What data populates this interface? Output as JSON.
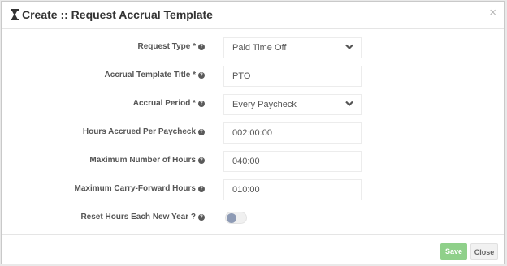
{
  "header": {
    "title": "Create :: Request Accrual Template",
    "title_icon": "hourglass-icon",
    "close_symbol": "×"
  },
  "form": {
    "request_type": {
      "label": "Request Type *",
      "value": "Paid Time Off"
    },
    "accrual_template_title": {
      "label": "Accrual Template Title *",
      "value": "PTO"
    },
    "accrual_period": {
      "label": "Accrual Period *",
      "value": "Every Paycheck"
    },
    "hours_accrued_per_paycheck": {
      "label": "Hours Accrued Per Paycheck",
      "value": "002:00:00"
    },
    "maximum_number_of_hours": {
      "label": "Maximum Number of Hours",
      "value": "040:00"
    },
    "maximum_carry_forward_hours": {
      "label": "Maximum Carry-Forward Hours",
      "value": "010:00"
    },
    "reset_hours_each_new_year": {
      "label": "Reset Hours Each New Year ?",
      "enabled": false
    },
    "help_symbol": "?"
  },
  "footer": {
    "save_label": "Save",
    "close_label": "Close"
  },
  "colors": {
    "save_button": "#8fd08a",
    "toggle_knob": "#8e9bb5"
  }
}
